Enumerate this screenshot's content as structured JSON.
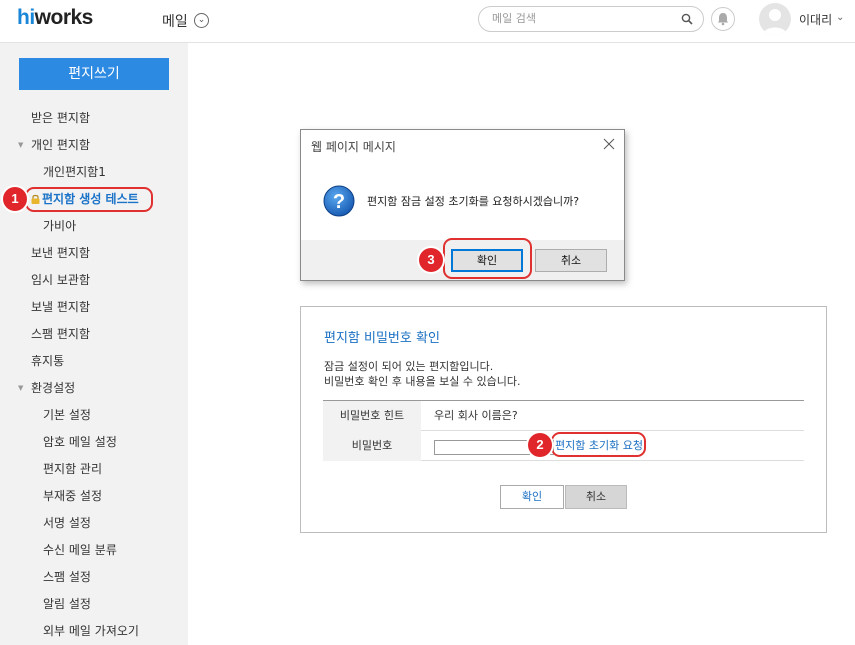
{
  "header": {
    "logo_prefix": "hi",
    "logo_suffix": "works",
    "app_title": "메일",
    "search_placeholder": "메일 검색",
    "user_name": "이대리"
  },
  "sidebar": {
    "compose_label": "편지쓰기",
    "items": [
      {
        "label": "받은 편지함"
      },
      {
        "label": "개인 편지함"
      },
      {
        "label": "개인편지함1"
      },
      {
        "label": "편지함 생성 테스트"
      },
      {
        "label": "가비아"
      },
      {
        "label": "보낸 편지함"
      },
      {
        "label": "임시 보관함"
      },
      {
        "label": "보낼 편지함"
      },
      {
        "label": "스팸 편지함"
      },
      {
        "label": "휴지통"
      },
      {
        "label": "환경설정"
      },
      {
        "label": "기본 설정"
      },
      {
        "label": "암호 메일 설정"
      },
      {
        "label": "편지함 관리"
      },
      {
        "label": "부재중 설정"
      },
      {
        "label": "서명 설정"
      },
      {
        "label": "수신 메일 분류"
      },
      {
        "label": "스팸 설정"
      },
      {
        "label": "알림 설정"
      },
      {
        "label": "외부 메일 가져오기"
      }
    ]
  },
  "dialog": {
    "title": "웹 페이지 메시지",
    "message": "편지함 잠금 설정 초기화를 요청하시겠습니까?",
    "ok_label": "확인",
    "cancel_label": "취소"
  },
  "panel": {
    "title": "편지함 비밀번호 확인",
    "desc_line1": "잠금 설정이 되어 있는 편지함입니다.",
    "desc_line2": "비밀번호 확인 후 내용을 보실 수 있습니다.",
    "hint_label": "비밀번호 힌트",
    "hint_value": "우리 회사 이름은?",
    "password_label": "비밀번호",
    "reset_link": "편지함 초기화 요청",
    "ok_label": "확인",
    "cancel_label": "취소"
  },
  "annotations": {
    "step1": "1",
    "step2": "2",
    "step3": "3"
  },
  "colors": {
    "accent": "#2d8ae2",
    "link": "#1a6fc2",
    "annotation": "#e0262b"
  }
}
